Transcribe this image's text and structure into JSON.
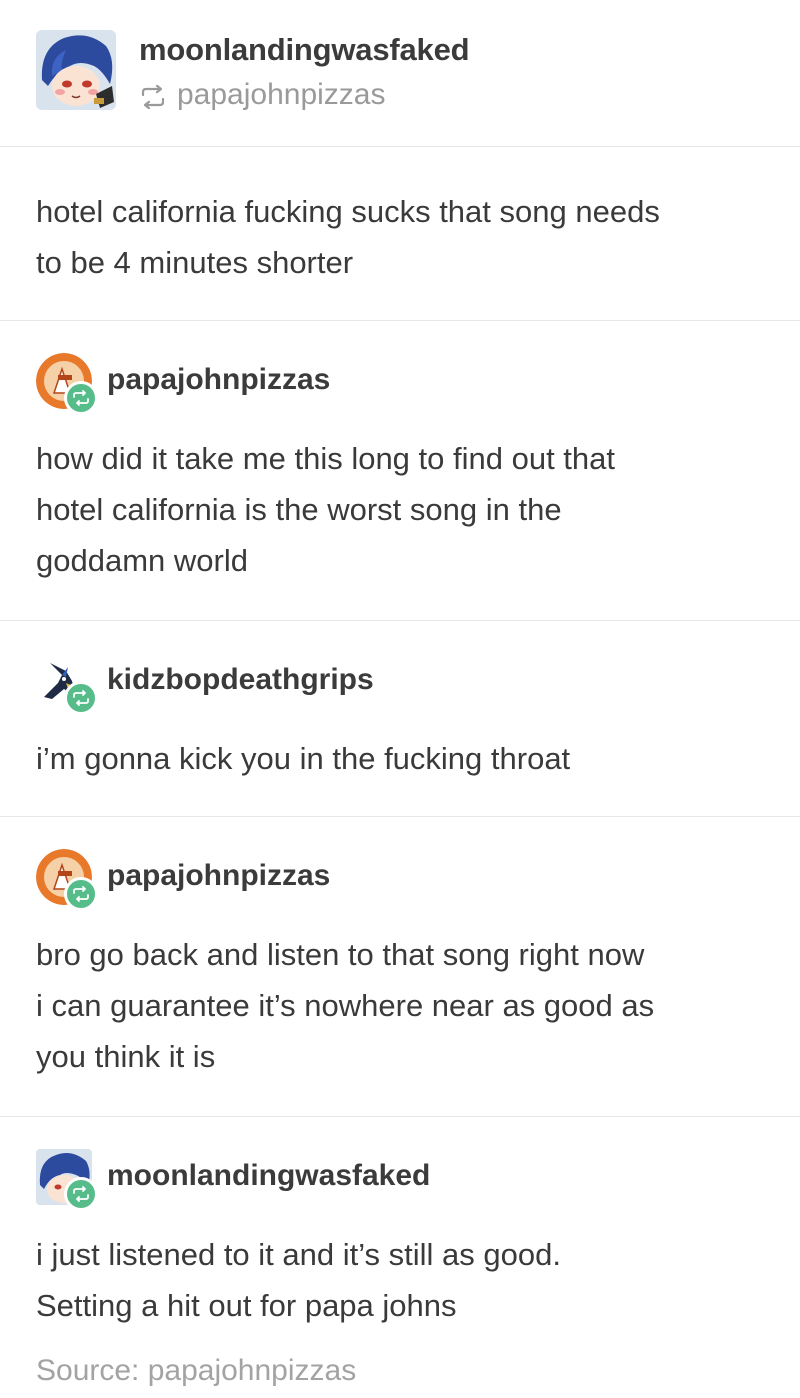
{
  "header": {
    "author": "moonlandingwasfaked",
    "reblogged_from": "papajohnpizzas"
  },
  "original_post": {
    "text": "hotel california fucking sucks that song needs\nto be 4 minutes shorter"
  },
  "reblogs": [
    {
      "username": "papajohnpizzas",
      "avatar": "papajohn-logo-avatar",
      "text": "how did it take me this long to find out that\nhotel california is the worst song in the\ngoddamn world"
    },
    {
      "username": "kidzbopdeathgrips",
      "avatar": "bird-avatar",
      "text": "i’m gonna kick you in the fucking throat"
    },
    {
      "username": "papajohnpizzas",
      "avatar": "papajohn-logo-avatar",
      "text": "bro go back and listen to that song right now\ni can guarantee it’s nowhere near as good as\nyou think it is"
    },
    {
      "username": "moonlandingwasfaked",
      "avatar": "anime-character-avatar",
      "text": "i just listened to it and it’s still as good.\nSetting a hit out for papa johns"
    }
  ],
  "footer": {
    "source_text": "Source: papajohnpizzas"
  },
  "colors": {
    "reblog_badge": "#56bc8a",
    "papajohn_orange": "#e8792b",
    "avatar_blue": "#2c4a9e",
    "muted_text": "#9a9a9a"
  },
  "icons": {
    "reblog": "reblog-icon"
  }
}
